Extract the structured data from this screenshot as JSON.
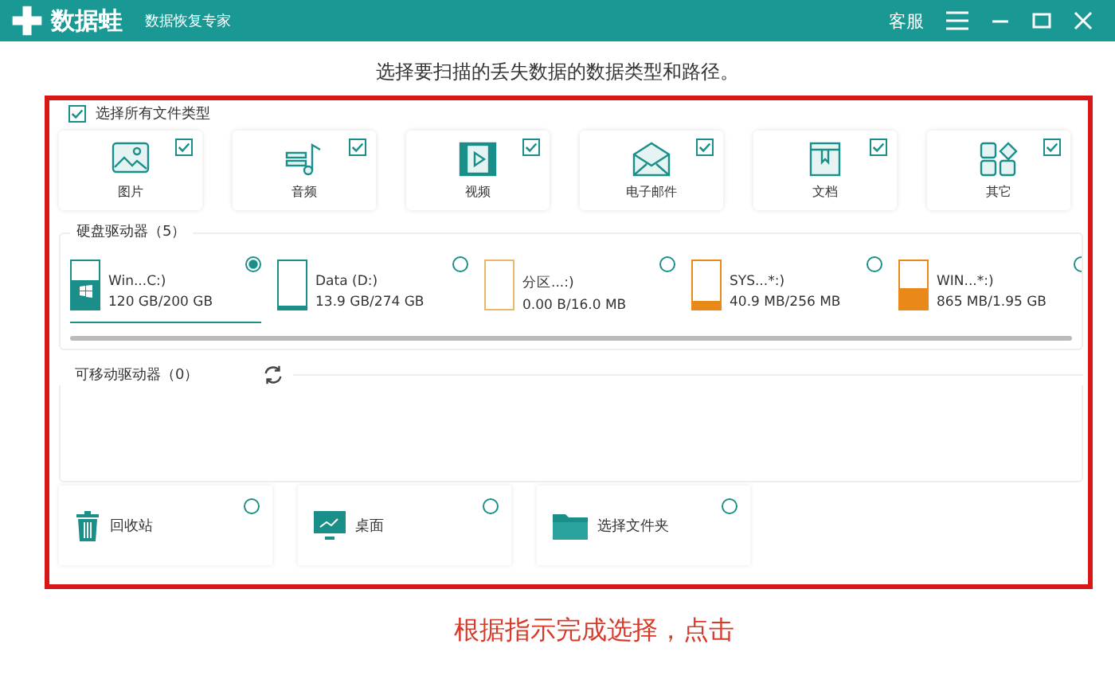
{
  "window": {
    "logo": "数据蛙",
    "subtitle": "数据恢复专家",
    "service": "客服"
  },
  "heading": "选择要扫描的丢失数据的数据类型和路径。",
  "select_all": {
    "label": "选择所有文件类型",
    "checked": true
  },
  "file_types": [
    {
      "label": "图片",
      "kind": "image",
      "checked": true
    },
    {
      "label": "音频",
      "kind": "audio",
      "checked": true
    },
    {
      "label": "视频",
      "kind": "video",
      "checked": true
    },
    {
      "label": "电子邮件",
      "kind": "email",
      "checked": true
    },
    {
      "label": "文档",
      "kind": "document",
      "checked": true
    },
    {
      "label": "其它",
      "kind": "other",
      "checked": true
    }
  ],
  "hard_drives": {
    "title": "硬盘驱动器（5）",
    "drives": [
      {
        "name": "Win...C:)",
        "usage": "120 GB/200 GB",
        "level": 0.6,
        "color": "#1a8f8a",
        "kind": "system",
        "selected": true
      },
      {
        "name": "Data (D:)",
        "usage": "13.9 GB/274 GB",
        "level": 0.06,
        "color": "#1a8f8a",
        "kind": "plain",
        "selected": false
      },
      {
        "name": "分区...:)",
        "usage": "0.00  B/16.0 MB",
        "level": 0,
        "color": "#e8b96a",
        "kind": "plain",
        "selected": false
      },
      {
        "name": "SYS...*:)",
        "usage": "40.9 MB/256 MB",
        "level": 0.17,
        "color": "#e8891a",
        "kind": "plain",
        "selected": false
      },
      {
        "name": "WIN...*:)",
        "usage": "865 MB/1.95 GB",
        "level": 0.45,
        "color": "#e8891a",
        "kind": "plain",
        "selected": false
      }
    ]
  },
  "removable": {
    "title": "可移动驱动器（0）"
  },
  "locations": [
    {
      "label": "回收站",
      "kind": "trash",
      "selected": false
    },
    {
      "label": "桌面",
      "kind": "desktop",
      "selected": false
    },
    {
      "label": "选择文件夹",
      "kind": "folder",
      "selected": false
    }
  ],
  "annotation": "根据指示完成选择，点击"
}
